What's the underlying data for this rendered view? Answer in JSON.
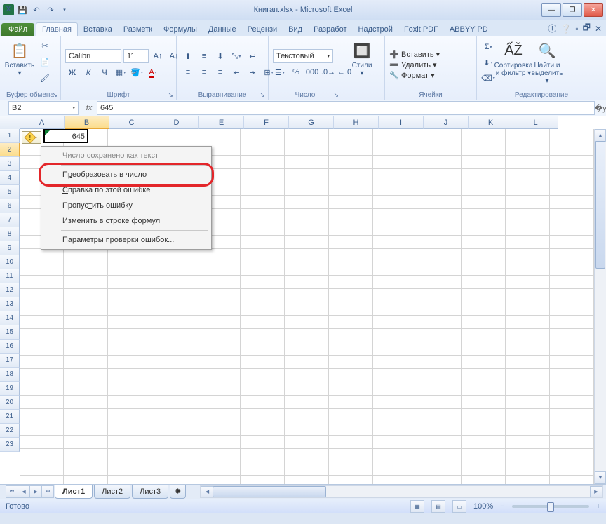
{
  "title": "Книгап.xlsx - Microsoft Excel",
  "tabs": {
    "file": "Файл",
    "home": "Главная",
    "insert": "Вставка",
    "layout": "Разметк",
    "formulas": "Формулы",
    "data": "Данные",
    "review": "Рецензи",
    "view": "Вид",
    "dev": "Разработ",
    "addins": "Надстрой",
    "foxit": "Foxit PDF",
    "abbyy": "ABBYY PD"
  },
  "ribbon": {
    "clipboard": {
      "paste": "Вставить",
      "label": "Буфер обмена"
    },
    "font": {
      "name": "Calibri",
      "size": "11",
      "label": "Шрифт"
    },
    "align": {
      "label": "Выравнивание"
    },
    "number": {
      "format": "Текстовый",
      "label": "Число"
    },
    "styles": {
      "btn": "Стили"
    },
    "cells": {
      "insert": "Вставить",
      "delete": "Удалить",
      "format": "Формат",
      "label": "Ячейки"
    },
    "editing": {
      "sort": "Сортировка и фильтр",
      "find": "Найти и выделить",
      "label": "Редактирование"
    }
  },
  "fx": {
    "cell": "B2",
    "value": "645"
  },
  "columns": [
    "A",
    "B",
    "C",
    "D",
    "E",
    "F",
    "G",
    "H",
    "I",
    "J",
    "K",
    "L"
  ],
  "rows_count": 23,
  "selected": {
    "col": "B",
    "row": 2,
    "display": "645"
  },
  "menu": {
    "i1": "Число сохранено как текст",
    "i2_pre": "П",
    "i2_ul": "р",
    "i2_post": "еобразовать в число",
    "i3_ul": "С",
    "i3_post": "правка по этой ошибке",
    "i4_pre": "Пропус",
    "i4_ul": "т",
    "i4_post": "ить ошибку",
    "i5_pre": "И",
    "i5_ul": "з",
    "i5_post": "менить в строке формул",
    "i6_pre": "Параметры проверки ош",
    "i6_ul": "и",
    "i6_post": "бок..."
  },
  "sheets": {
    "s1": "Лист1",
    "s2": "Лист2",
    "s3": "Лист3"
  },
  "status": {
    "ready": "Готово",
    "zoom": "100%"
  }
}
